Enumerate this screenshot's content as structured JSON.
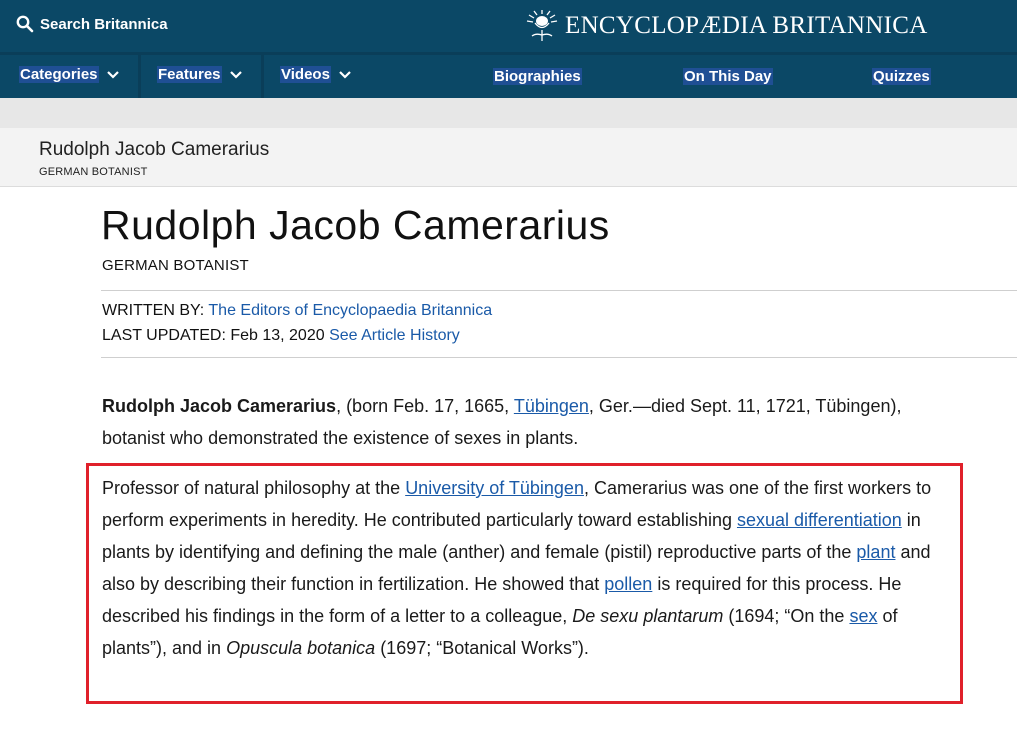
{
  "header": {
    "search_label": "Search Britannica",
    "brand_name": "ENCYCLOPÆDIA BRITANNICA",
    "brand_color": "#0b4866"
  },
  "nav": {
    "categories": "Categories",
    "features": "Features",
    "videos": "Videos",
    "biographies": "Biographies",
    "on_this_day": "On This Day",
    "quizzes": "Quizzes"
  },
  "sticky": {
    "title": "Rudolph Jacob Camerarius",
    "subtitle": "GERMAN BOTANIST"
  },
  "article": {
    "title": "Rudolph Jacob Camerarius",
    "subtitle": "GERMAN BOTANIST",
    "written_by_label": "WRITTEN BY: ",
    "written_by_link": "The Editors of Encyclopaedia Britannica",
    "updated_label": "LAST UPDATED: Feb 13, 2020 ",
    "history_link": "See Article History",
    "p1": {
      "name_bold": "Rudolph Jacob Camerarius",
      "t1": ", (born Feb. 17, 1665, ",
      "link_tubingen": "Tübingen",
      "t2": ", Ger.—died Sept. 11, 1721, Tübingen), botanist who demonstrated the existence of sexes in plants."
    },
    "p2": {
      "t1": "Professor of natural philosophy at the ",
      "link_university": "University of Tübingen",
      "t2": ", Camerarius was one of the first workers to perform experiments in heredity. He contributed particularly toward establishing ",
      "link_sexual_diff": "sexual differentiation",
      "t3": " in plants by identifying and defining the male (anther) and female (pistil) reproductive parts of the ",
      "link_plant": "plant",
      "t4": " and also by describing their function in fertilization. He showed that ",
      "link_pollen": "pollen",
      "t5": " is required for this process. He described his findings in the form of a letter to a colleague, ",
      "italic1": "De sexu plantarum",
      "t6": " (1694; “On the ",
      "link_sex": "sex",
      "t7": " of plants”), and in ",
      "italic2": "Opuscula botanica",
      "t8": " (1697; “Botanical Works”)."
    },
    "highlight_color": "#e0202a"
  }
}
